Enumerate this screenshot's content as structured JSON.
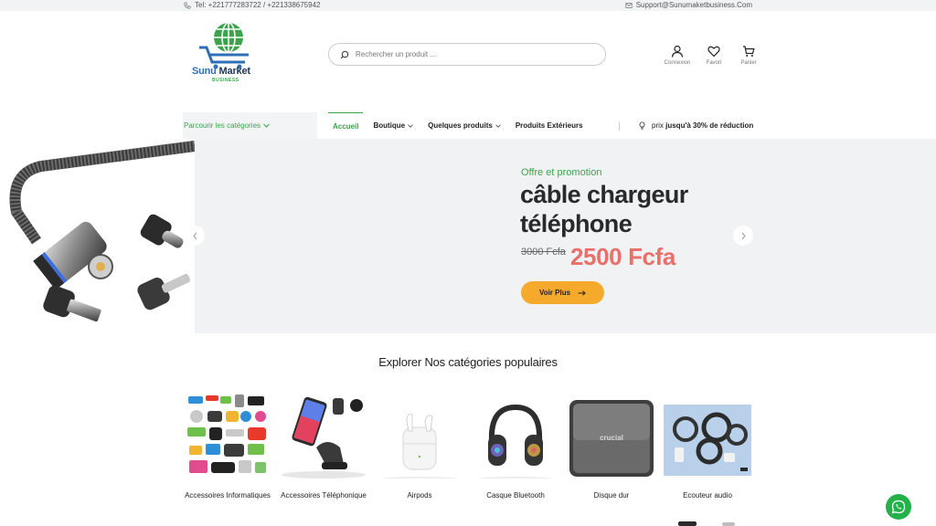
{
  "topbar": {
    "phone": "Tel: +221777283722 / +221338675942",
    "email": "Support@Sunumaketbusiness.Com"
  },
  "brand": {
    "name_part1": "Sunu",
    "name_part2": " Market",
    "tagline": "BUSINESS"
  },
  "search": {
    "placeholder": "Rechercher un produit ..."
  },
  "header_icons": [
    {
      "label": "Connexion",
      "icon": "user-icon"
    },
    {
      "label": "Favori",
      "icon": "heart-icon"
    },
    {
      "label": "Panier",
      "icon": "cart-icon"
    }
  ],
  "nav": {
    "categories_label": "Parcourir les catégories",
    "items": [
      {
        "label": "Accueil",
        "active": true
      },
      {
        "label": "Boutique",
        "dropdown": true
      },
      {
        "label": "Quelques produits",
        "dropdown": true
      },
      {
        "label": "Produits Extérieurs"
      }
    ],
    "promo_prefix": "prix",
    "promo_text": "jusqu'à 30% de réduction"
  },
  "hero": {
    "subtitle": "Offre et promotion",
    "title": "câble chargeur téléphone",
    "old_price": "3000 Fcfa",
    "new_price": "2500 Fcfa",
    "button": "Voir Plus",
    "button_icon": "arrow-right-icon"
  },
  "categories": {
    "title": "Explorer Nos catégories populaires",
    "items": [
      {
        "name": "Accessoires Informatiques"
      },
      {
        "name": "Accessoires Téléphonique"
      },
      {
        "name": "Airpods"
      },
      {
        "name": "Casque Bluetooth"
      },
      {
        "name": "Disque dur"
      },
      {
        "name": "Ecouteur audio"
      }
    ]
  },
  "colors": {
    "accent_green": "#3ca34a",
    "price_red": "#e8706a",
    "button_orange": "#f6aa2c",
    "whatsapp_green": "#25b14a"
  }
}
